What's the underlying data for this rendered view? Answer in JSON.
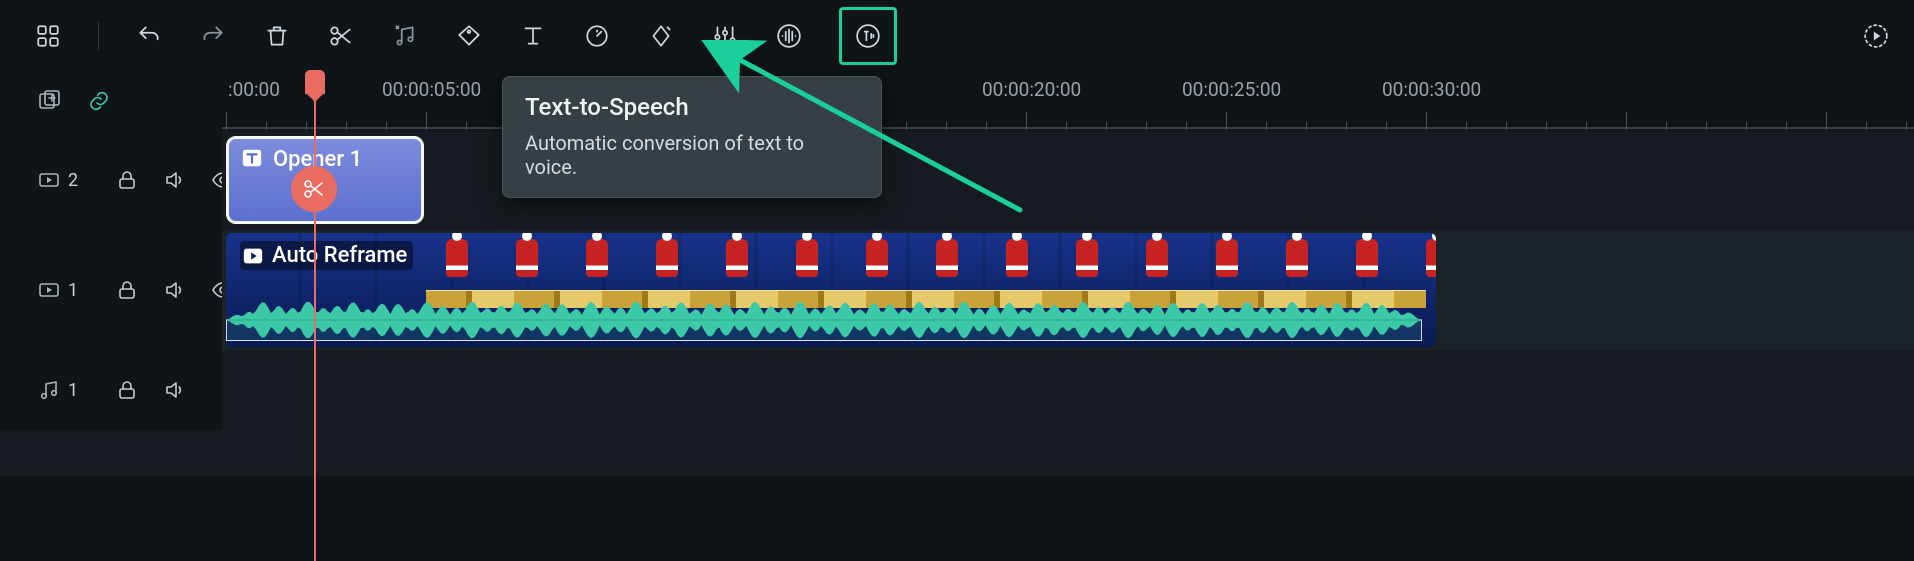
{
  "toolbar": {
    "tts_tooltip": {
      "title": "Text-to-Speech",
      "desc": "Automatic conversion of text to voice."
    }
  },
  "timeline": {
    "labels": [
      ":00:00",
      "00:00:05:00",
      "00:00:20:00",
      "00:00:25:00",
      "00:00:30:00"
    ]
  },
  "tracks": {
    "text": {
      "num": "2",
      "clip_label": "Opener 1"
    },
    "video": {
      "num": "1",
      "clip_label": "Auto Reframe"
    },
    "audio": {
      "num": "1"
    }
  }
}
